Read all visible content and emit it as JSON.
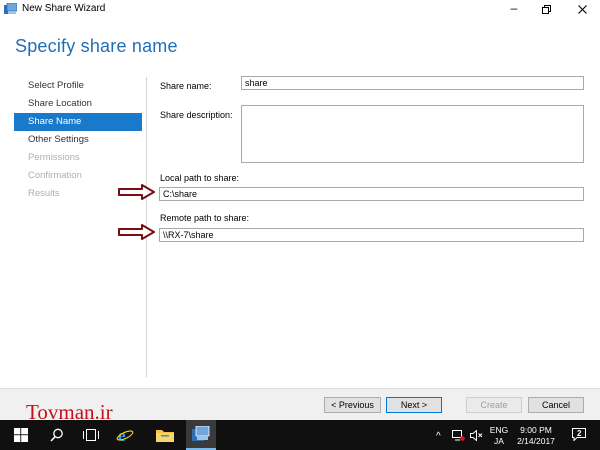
{
  "window": {
    "title": "New Share Wizard"
  },
  "page": {
    "heading": "Specify share name"
  },
  "nav": {
    "items": [
      {
        "label": "Select Profile",
        "state": "normal"
      },
      {
        "label": "Share Location",
        "state": "normal"
      },
      {
        "label": "Share Name",
        "state": "active"
      },
      {
        "label": "Other Settings",
        "state": "normal"
      },
      {
        "label": "Permissions",
        "state": "disabled"
      },
      {
        "label": "Confirmation",
        "state": "disabled"
      },
      {
        "label": "Results",
        "state": "disabled"
      }
    ]
  },
  "form": {
    "share_name_label": "Share name:",
    "share_name_value": "share",
    "share_desc_label": "Share description:",
    "share_desc_value": "",
    "local_path_label": "Local path to share:",
    "local_path_value": "C:\\share",
    "remote_path_label": "Remote path to share:",
    "remote_path_value": "\\\\RX-7\\share"
  },
  "buttons": {
    "previous": "< Previous",
    "next": "Next >",
    "create": "Create",
    "cancel": "Cancel"
  },
  "watermark": "Tovman.ir",
  "taskbar": {
    "lang_top": "ENG",
    "lang_bottom": "JA",
    "time": "9:00 PM",
    "date": "2/14/2017",
    "notification_count": "2"
  },
  "colors": {
    "accent": "#1979ca",
    "heading": "#1e6fb8",
    "arrow": "#7a0d12"
  }
}
